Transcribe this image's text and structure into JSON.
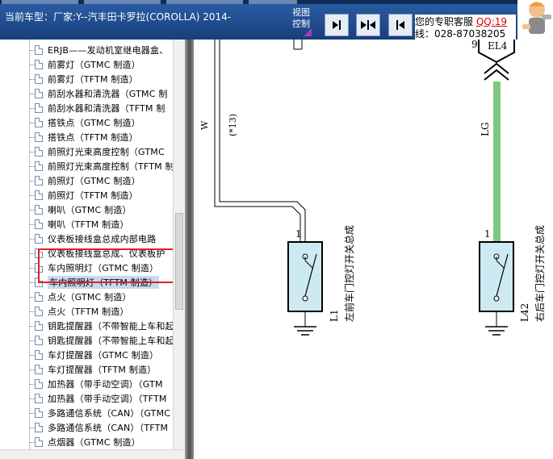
{
  "header": {
    "car_model": "当前车型：厂家:Y--汽丰田卡罗拉(COROLLA) 2014-",
    "view_control_label_1": "视图",
    "view_control_label_2": "控制",
    "service_label": "您的专职客服",
    "qq_label": "QQ:19",
    "phone_label": "线：028-87038205"
  },
  "tree": {
    "items": [
      {
        "label": "ERJB——发动机室继电器盒、"
      },
      {
        "label": "前雾灯（GTMC 制造）"
      },
      {
        "label": "前雾灯（TFTM 制造）"
      },
      {
        "label": "前刮水器和清洗器（GTMC 制"
      },
      {
        "label": "前刮水器和清洗器（TFTM 制"
      },
      {
        "label": "搭铁点（GTMC 制造）"
      },
      {
        "label": "搭铁点（TFTM 制造）"
      },
      {
        "label": "前照灯光束高度控制（GTMC"
      },
      {
        "label": "前照灯光束高度控制（TFTM 制"
      },
      {
        "label": "前照灯（GTMC 制造）"
      },
      {
        "label": "前照灯（TFTM 制造）"
      },
      {
        "label": "喇叭（GTMC 制造）"
      },
      {
        "label": "喇叭（TFTM 制造）"
      },
      {
        "label": "仪表板接线盒总成内部电路"
      },
      {
        "label": "仪表板接线盒总成、仪表板护"
      },
      {
        "label": "车内照明灯（GTMC 制造）"
      },
      {
        "label": "车内照明灯（TFTM 制造）"
      },
      {
        "label": "点火（GTMC 制造）"
      },
      {
        "label": "点火（TFTM 制造）"
      },
      {
        "label": "钥匙提醒器（不带智能上车和起"
      },
      {
        "label": "钥匙提醒器（不带智能上车和起"
      },
      {
        "label": "车灯提醒器（GTMC 制造）"
      },
      {
        "label": "车灯提醒器（TFTM 制造）"
      },
      {
        "label": "加热器（带手动空调）（GTM"
      },
      {
        "label": "加热器（带手动空调）（TFTM"
      },
      {
        "label": "多路通信系统（CAN）（GTMC"
      },
      {
        "label": "多路通信系统（CAN）（TFTM"
      },
      {
        "label": "点烟器（GTMC 制造）"
      },
      {
        "label": "点烟器（TFTM 制造）"
      }
    ]
  },
  "diagram": {
    "wire_left_color": "W",
    "wire_left_note": "(*13)",
    "wire_right_color": "LG",
    "connector_pin": "9",
    "connector_label": "EL4",
    "left_pin": "1",
    "right_pin": "1",
    "left_component_id": "L1",
    "left_component_name": "左前车门控灯开关总成",
    "right_component_id": "L42",
    "right_component_name": "右后车门控灯开关总成",
    "colors": {
      "switch_fill": "#cdeaf2",
      "green_wire": "#7ec97e"
    }
  }
}
